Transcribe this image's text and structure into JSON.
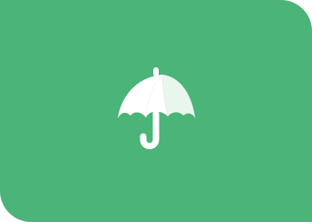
{
  "tile": {
    "background_color": "#4BB478",
    "icon": {
      "name": "umbrella-icon",
      "color": "#FFFFFF",
      "shade_color": "#E9F6EE"
    }
  }
}
